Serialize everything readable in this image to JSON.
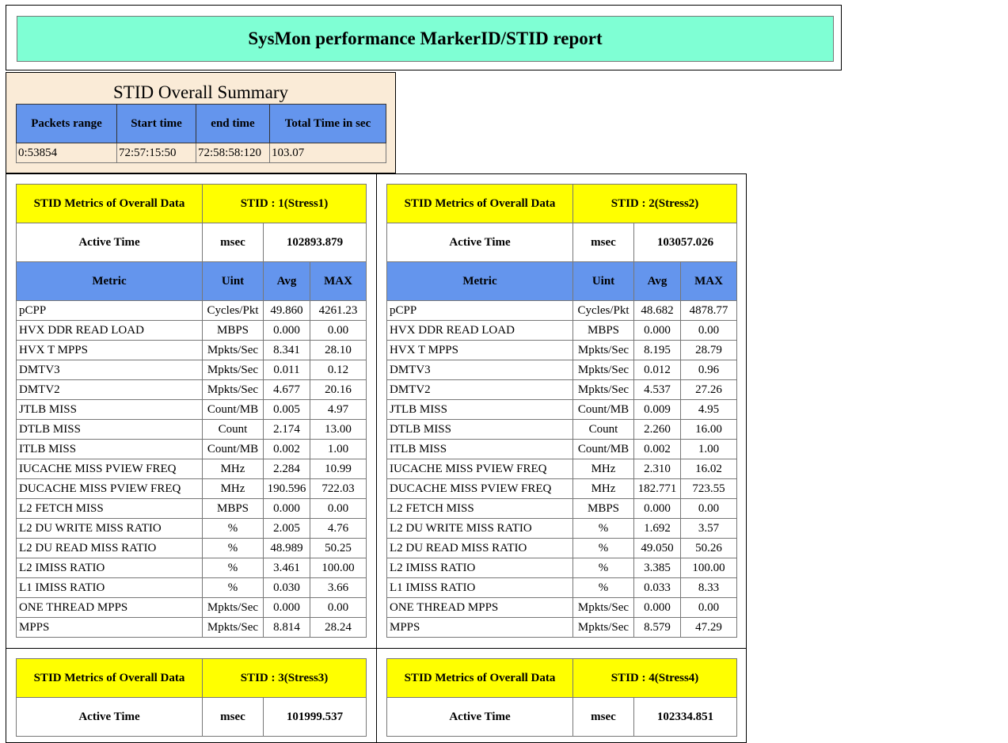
{
  "report": {
    "title": "SysMon performance MarkerID/STID report"
  },
  "summary": {
    "title": "STID Overall Summary",
    "headers": [
      "Packets range",
      "Start time",
      "end time",
      "Total Time in sec"
    ],
    "row": [
      "0:53854",
      "72:57:15:50",
      "72:58:58:120",
      "103.07"
    ]
  },
  "panel_common": {
    "header_label": "STID Metrics of Overall Data",
    "active_time_label": "Active Time",
    "active_time_unit": "msec",
    "columns": [
      "Metric",
      "Uint",
      "Avg",
      "MAX"
    ]
  },
  "panels": [
    {
      "stid": "STID : 1(Stress1)",
      "active_time": "102893.879",
      "rows": [
        [
          "pCPP",
          "Cycles/Pkt",
          "49.860",
          "4261.23"
        ],
        [
          "HVX DDR READ LOAD",
          "MBPS",
          "0.000",
          "0.00"
        ],
        [
          "HVX T MPPS",
          "Mpkts/Sec",
          "8.341",
          "28.10"
        ],
        [
          "DMTV3",
          "Mpkts/Sec",
          "0.011",
          "0.12"
        ],
        [
          "DMTV2",
          "Mpkts/Sec",
          "4.677",
          "20.16"
        ],
        [
          "JTLB MISS",
          "Count/MB",
          "0.005",
          "4.97"
        ],
        [
          "DTLB MISS",
          "Count",
          "2.174",
          "13.00"
        ],
        [
          "ITLB MISS",
          "Count/MB",
          "0.002",
          "1.00"
        ],
        [
          "IUCACHE MISS PVIEW FREQ",
          "MHz",
          "2.284",
          "10.99"
        ],
        [
          "DUCACHE MISS PVIEW FREQ",
          "MHz",
          "190.596",
          "722.03"
        ],
        [
          "L2 FETCH MISS",
          "MBPS",
          "0.000",
          "0.00"
        ],
        [
          "L2 DU WRITE MISS RATIO",
          "%",
          "2.005",
          "4.76"
        ],
        [
          "L2 DU READ MISS RATIO",
          "%",
          "48.989",
          "50.25"
        ],
        [
          "L2 IMISS RATIO",
          "%",
          "3.461",
          "100.00"
        ],
        [
          "L1 IMISS RATIO",
          "%",
          "0.030",
          "3.66"
        ],
        [
          "ONE THREAD MPPS",
          "Mpkts/Sec",
          "0.000",
          "0.00"
        ],
        [
          "MPPS",
          "Mpkts/Sec",
          "8.814",
          "28.24"
        ]
      ]
    },
    {
      "stid": "STID : 2(Stress2)",
      "active_time": "103057.026",
      "rows": [
        [
          "pCPP",
          "Cycles/Pkt",
          "48.682",
          "4878.77"
        ],
        [
          "HVX DDR READ LOAD",
          "MBPS",
          "0.000",
          "0.00"
        ],
        [
          "HVX T MPPS",
          "Mpkts/Sec",
          "8.195",
          "28.79"
        ],
        [
          "DMTV3",
          "Mpkts/Sec",
          "0.012",
          "0.96"
        ],
        [
          "DMTV2",
          "Mpkts/Sec",
          "4.537",
          "27.26"
        ],
        [
          "JTLB MISS",
          "Count/MB",
          "0.009",
          "4.95"
        ],
        [
          "DTLB MISS",
          "Count",
          "2.260",
          "16.00"
        ],
        [
          "ITLB MISS",
          "Count/MB",
          "0.002",
          "1.00"
        ],
        [
          "IUCACHE MISS PVIEW FREQ",
          "MHz",
          "2.310",
          "16.02"
        ],
        [
          "DUCACHE MISS PVIEW FREQ",
          "MHz",
          "182.771",
          "723.55"
        ],
        [
          "L2 FETCH MISS",
          "MBPS",
          "0.000",
          "0.00"
        ],
        [
          "L2 DU WRITE MISS RATIO",
          "%",
          "1.692",
          "3.57"
        ],
        [
          "L2 DU READ MISS RATIO",
          "%",
          "49.050",
          "50.26"
        ],
        [
          "L2 IMISS RATIO",
          "%",
          "3.385",
          "100.00"
        ],
        [
          "L1 IMISS RATIO",
          "%",
          "0.033",
          "8.33"
        ],
        [
          "ONE THREAD MPPS",
          "Mpkts/Sec",
          "0.000",
          "0.00"
        ],
        [
          "MPPS",
          "Mpkts/Sec",
          "8.579",
          "47.29"
        ]
      ]
    },
    {
      "stid": "STID : 3(Stress3)",
      "active_time": "101999.537",
      "rows": []
    },
    {
      "stid": "STID : 4(Stress4)",
      "active_time": "102334.851",
      "rows": []
    }
  ]
}
